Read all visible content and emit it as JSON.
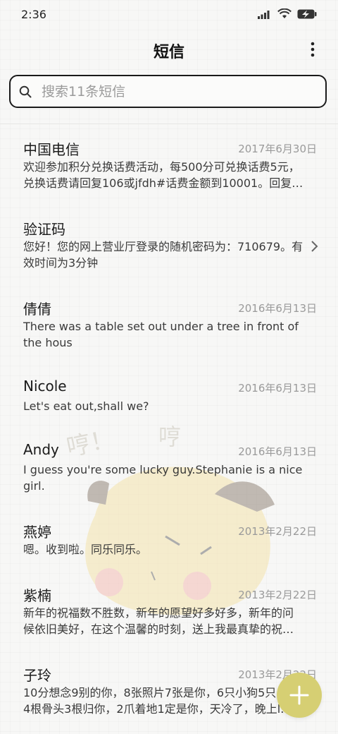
{
  "status_bar": {
    "time": "2:36"
  },
  "header": {
    "title": "短信"
  },
  "search": {
    "placeholder": "搜索11条短信"
  },
  "colors": {
    "fab": "#d6cf73",
    "background": "#f7f7f6",
    "secondary_text": "#9a9a9a"
  },
  "messages": [
    {
      "name": "中国电信",
      "date": "2017年6月30日",
      "line1": "欢迎参加积分兑换话费活动，每500分可兑换话费5元，",
      "line2": "兑换话费请回复106或jfdh#话费金额到10001。回复…"
    },
    {
      "name": "验证码",
      "date": "",
      "line1": "您好！您的网上营业厅登录的随机密码为：710679。有",
      "line2": "效时间为3分钟"
    },
    {
      "name": "倩倩",
      "date": "2016年6月13日",
      "line1": "There was a table set out under a tree in front of",
      "line2": "the hous"
    },
    {
      "name": "Nicole",
      "date": "2016年6月13日",
      "line1": "Let's eat out,shall we?",
      "line2": ""
    },
    {
      "name": "Andy",
      "date": "2016年6月13日",
      "line1": "I guess you're some lucky guy.Stephanie is a nice",
      "line2": "girl."
    },
    {
      "name": "燕婷",
      "date": "2013年2月22日",
      "line1": "嗯。收到啦。同乐同乐。",
      "line2": ""
    },
    {
      "name": "紫楠",
      "date": "2013年2月22日",
      "line1": "新年的祝福数不胜数，新年的愿望好多好多，新年的问",
      "line2": "候依旧美好，在这个温馨的时刻，送上我最真挚的祝…"
    },
    {
      "name": "子玲",
      "date": "2013年2月22日",
      "line1": "10分想念9别的你，8张照片7张是你，6只小狗5只",
      "line2": "4根骨头3根归你，2爪着地1定是你，天冷了，晚上l…"
    }
  ],
  "watermark_text": {
    "left": "哼！",
    "right": "哼"
  },
  "icons": {
    "menu": "more-vertical-icon",
    "search": "search-icon",
    "fab": "plus-icon",
    "chevron": "chevron-right-icon"
  }
}
